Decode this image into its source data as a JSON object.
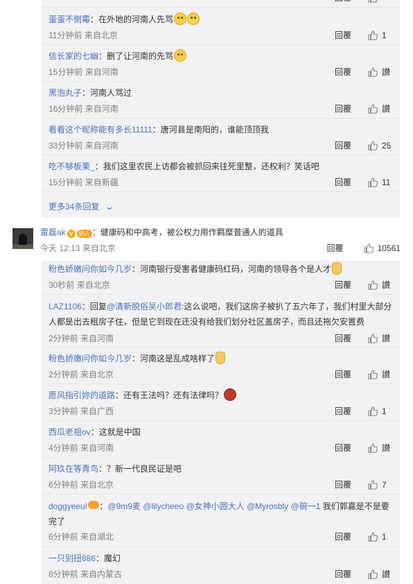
{
  "top_replies": [
    {
      "user": "蛋蛋不倒霉",
      "text": "：在外地的河南人先骂",
      "emojis": [
        "smile",
        "smile"
      ],
      "time": "11分钟前",
      "source": "来自北京",
      "reply": "回覆",
      "likes": "1"
    },
    {
      "user": "信长家的七幽",
      "text": "：删了让河南的先骂",
      "emojis": [
        "smile"
      ],
      "time": "15分钟前",
      "source": "来自河南",
      "reply": "回覆",
      "likes": "讃"
    },
    {
      "user": "黑泡丸子",
      "text": "：河南人骂过",
      "emojis": [],
      "time": "16分钟前",
      "source": "来自河南",
      "reply": "回覆",
      "likes": "讃"
    },
    {
      "user": "看看这个昵称能有多长11111",
      "text": "：唐河县是南阳的，谁能顶顶我",
      "emojis": [],
      "time": "33分钟前",
      "source": "来自河南",
      "reply": "回覆",
      "likes": "25"
    },
    {
      "user": "吃不够板栗_",
      "text": "：我们这里农民上访都会被抓回来往死里整，还权利？笑话吧",
      "emojis": [],
      "time": "15分钟前",
      "source": "来自新疆",
      "reply": "回覆",
      "likes": "11"
    }
  ],
  "more_replies": "更多34条回复",
  "main_comment": {
    "user": "雷磊ak",
    "badge_v": "V",
    "badge_lv": "达人",
    "text": "：健康码和中高考，被公权力用作羁糜普通人的道具",
    "time": "今天 12:13",
    "source": "来自北京",
    "reply": "回覆",
    "likes": "10561"
  },
  "bottom_replies": [
    {
      "user": "粉色娇嫩问你如今几岁",
      "pre": "",
      "mention": "",
      "text": "：河南银行受害者健康码红码，河南的领导各个是人才",
      "emojis": [
        "thumb"
      ],
      "time": "30秒前",
      "source": "来自北京",
      "reply": "回覆",
      "likes": "讃"
    },
    {
      "user": "LAZ1106",
      "pre": "：回复",
      "mention": "@清新脱俗吴小郎君",
      "text": ":这么说吧，我们这房子被扒了五六年了，我们村里大部分人都是出去租房子住，但是它到现在还没有给我们划分社区盖房子，而且还拖欠安置费",
      "emojis": [],
      "time": "2分钟前",
      "source": "来自河南",
      "reply": "回覆",
      "likes": "讃"
    },
    {
      "user": "粉色娇嫩问你如今几岁",
      "pre": "",
      "mention": "",
      "text": "：河南这是乱成啥样了",
      "emojis": [
        "thumb"
      ],
      "time": "2分钟前",
      "source": "来自北京",
      "reply": "回覆",
      "likes": "讃"
    },
    {
      "user": "愿风指引妳的道路",
      "pre": "",
      "mention": "",
      "text": "：还有王法吗？还有法律吗？",
      "emojis": [
        "devil"
      ],
      "time": "3分钟前",
      "source": "来自广西",
      "reply": "回覆",
      "likes": "1"
    },
    {
      "user": "西瓜老祖ov",
      "pre": "",
      "mention": "",
      "text": "：这就是中国",
      "emojis": [],
      "time": "4分钟前",
      "source": "来自河南",
      "reply": "回覆",
      "likes": "讃"
    },
    {
      "user": "阿玖在等青鸟",
      "pre": "",
      "mention": "",
      "text": "：？新一代良民证是吧",
      "emojis": [],
      "time": "6分钟前",
      "source": "来自北京",
      "reply": "回覆",
      "likes": "7"
    },
    {
      "user": "doggyeeul",
      "pre": "：",
      "mention": "@9m9麦 @lilycheeo @女神小圆大人 @Myrosbly @碗一1",
      "text": " 我们郭嘉是不是要完了",
      "emojis": [],
      "time": "6分钟前",
      "source": "来自湖北",
      "reply": "回覆",
      "likes": "1"
    },
    {
      "user": "一只别扭886",
      "pre": "",
      "mention": "",
      "text": "：魔幻",
      "emojis": [],
      "time": "8分钟前",
      "source": "来自内蒙古",
      "reply": "回覆",
      "likes": "讃"
    }
  ]
}
